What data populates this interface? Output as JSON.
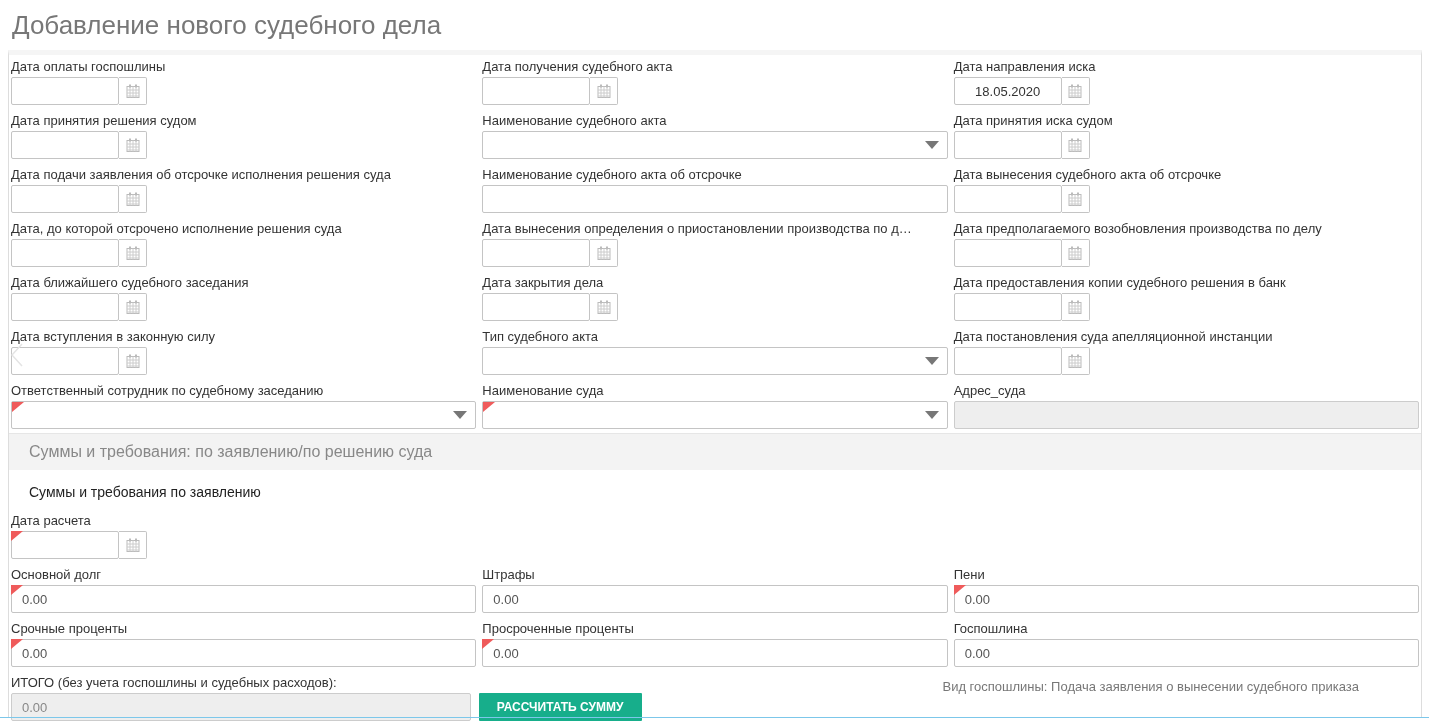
{
  "title": "Добавление нового судебного дела",
  "fields": [
    {
      "label": "Дата оплаты госпошлины",
      "kind": "date",
      "required": false
    },
    {
      "label": "Дата получения судебного акта",
      "kind": "date",
      "required": false
    },
    {
      "label": "Дата направления иска",
      "kind": "date",
      "required": false,
      "value": "18.05.2020"
    },
    {
      "label": "Дата принятия решения судом",
      "kind": "date",
      "required": false
    },
    {
      "label": "Наименование судебного акта",
      "kind": "select",
      "required": false
    },
    {
      "label": "Дата принятия иска судом",
      "kind": "date",
      "required": false
    },
    {
      "label": "Дата подачи заявления об отсрочке исполнения решения суда",
      "kind": "date",
      "required": false
    },
    {
      "label": "Наименование судебного акта об отсрочке",
      "kind": "text",
      "required": false
    },
    {
      "label": "Дата вынесения судебного акта об отсрочке",
      "kind": "date",
      "required": false
    },
    {
      "label": "Дата, до которой отсрочено исполнение решения суда",
      "kind": "date",
      "required": false
    },
    {
      "label": "Дата вынесения определения о приостановлении производства по д…",
      "kind": "date",
      "required": false
    },
    {
      "label": "Дата предполагаемого возобновления производства по делу",
      "kind": "date",
      "required": false
    },
    {
      "label": "Дата ближайшего судебного заседания",
      "kind": "date",
      "required": false
    },
    {
      "label": "Дата закрытия дела",
      "kind": "date",
      "required": false
    },
    {
      "label": "Дата предоставления копии судебного решения в банк",
      "kind": "date",
      "required": false
    },
    {
      "label": "Дата вступления в законную силу",
      "kind": "date",
      "required": false
    },
    {
      "label": "Тип судебного акта",
      "kind": "select",
      "required": false
    },
    {
      "label": "Дата постановления суда апелляционной инстанции",
      "kind": "date",
      "required": false
    },
    {
      "label": "Ответственный сотрудник по судебному заседанию",
      "kind": "select",
      "required": true
    },
    {
      "label": "Наименование суда",
      "kind": "select",
      "required": true
    },
    {
      "label": "Адрес_суда",
      "kind": "readonly",
      "required": false
    }
  ],
  "section": {
    "title": "Суммы и требования: по заявлению/по решению суда",
    "subtitle": "Суммы и требования по заявлению"
  },
  "calc_date": {
    "label": "Дата расчета",
    "kind": "date",
    "required": true
  },
  "amounts": [
    {
      "label": "Основной долг",
      "kind": "text",
      "required": true,
      "value": "0.00"
    },
    {
      "label": "Штрафы",
      "kind": "text",
      "required": false,
      "value": "0.00"
    },
    {
      "label": "Пени",
      "kind": "text",
      "required": true,
      "value": "0.00"
    },
    {
      "label": "Срочные проценты",
      "kind": "text",
      "required": true,
      "value": "0.00"
    },
    {
      "label": "Просроченные проценты",
      "kind": "text",
      "required": true,
      "value": "0.00"
    },
    {
      "label": "Госпошлина",
      "kind": "text",
      "required": false,
      "value": "0.00"
    }
  ],
  "total": {
    "label": "ИТОГО (без учета госпошлины и судебных расходов):",
    "kind": "readonly",
    "required": false,
    "value": "0.00"
  },
  "calc_button": "РАССЧИТАТЬ СУММУ",
  "fee_note": "Вид госпошлины: Подача заявления о вынесении судебного приказа"
}
